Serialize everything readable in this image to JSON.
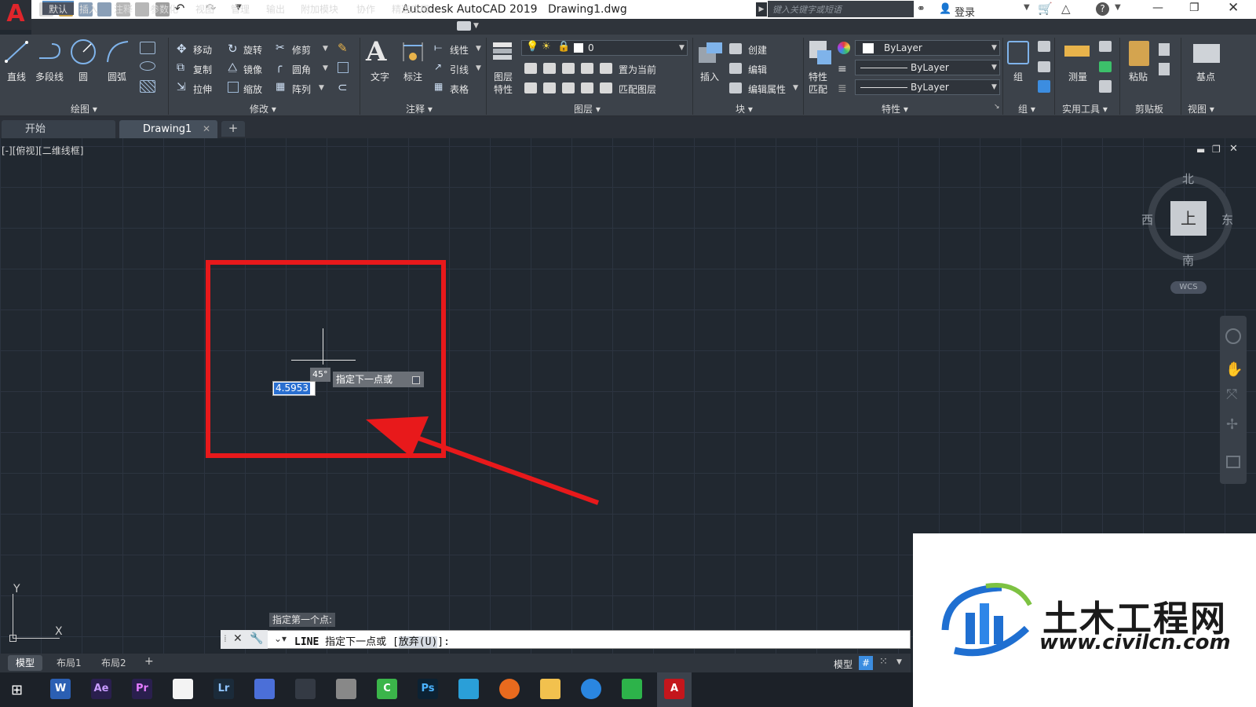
{
  "app": {
    "title": "Autodesk AutoCAD 2019",
    "document": "Drawing1.dwg",
    "search_placeholder": "键入关键字或短语",
    "login": "登录",
    "logo_letter": "A"
  },
  "menu": [
    "默认",
    "插入",
    "注释",
    "参数化",
    "视图",
    "管理",
    "输出",
    "附加模块",
    "协作",
    "精选应用"
  ],
  "ribbon": {
    "draw": {
      "line": "直线",
      "polyline": "多段线",
      "circle": "圆",
      "arc": "圆弧",
      "title": "绘图"
    },
    "modify": {
      "move": "移动",
      "rotate": "旋转",
      "trim": "修剪",
      "copy": "复制",
      "mirror": "镜像",
      "fillet": "圆角",
      "stretch": "拉伸",
      "scale": "缩放",
      "array": "阵列",
      "title": "修改"
    },
    "annotation": {
      "text": "文字",
      "dimension": "标注",
      "linear": "线性",
      "leader": "引线",
      "table": "表格",
      "title": "注释"
    },
    "layers": {
      "layer_props_1": "图层",
      "layer_props_2": "特性",
      "current_layer": "0",
      "make_current": "置为当前",
      "match_layer": "匹配图层",
      "title": "图层"
    },
    "block": {
      "insert": "插入",
      "create": "创建",
      "edit": "编辑",
      "edit_attr": "编辑属性",
      "title": "块"
    },
    "properties": {
      "match_1": "特性",
      "match_2": "匹配",
      "color": "ByLayer",
      "linetype": "ByLayer",
      "lineweight": "ByLayer",
      "title": "特性"
    },
    "groups": {
      "group": "组",
      "title": "组"
    },
    "utilities": {
      "measure": "测量",
      "title": "实用工具"
    },
    "clipboard": {
      "paste": "粘贴",
      "title": "剪贴板"
    },
    "view": {
      "base": "基点",
      "title": "视图"
    }
  },
  "tabs": {
    "start": "开始",
    "drawing": "Drawing1",
    "add": "+"
  },
  "viewport": {
    "label": "[-][俯视][二维线框]",
    "viewcube": {
      "north": "北",
      "south": "南",
      "east": "东",
      "west": "西",
      "top": "上",
      "wcs": "WCS"
    },
    "dynamic_input": {
      "length": "4.5953",
      "angle": "45°",
      "prompt": "指定下一点或"
    },
    "ucs": {
      "y": "Y",
      "x": "X"
    }
  },
  "command": {
    "history": "指定第一个点:",
    "prompt_cmd": "LINE",
    "prompt_text": "指定下一点或 [",
    "option": "放弃(U)",
    "prompt_end": "]:"
  },
  "layouts": [
    "模型",
    "布局1",
    "布局2"
  ],
  "status": {
    "model": "模型"
  },
  "taskbar": [
    "W",
    "Ae",
    "Pr",
    "",
    "Lr",
    "",
    "",
    "",
    "C",
    "Ps",
    "",
    "",
    "",
    "",
    "",
    "A"
  ],
  "watermark": {
    "name": "土木工程网",
    "url": "www.civilcn.com"
  },
  "colors": {
    "annotation_red": "#e8191b",
    "accent_blue": "#1f6fd1",
    "dark_bg": "#212830"
  }
}
